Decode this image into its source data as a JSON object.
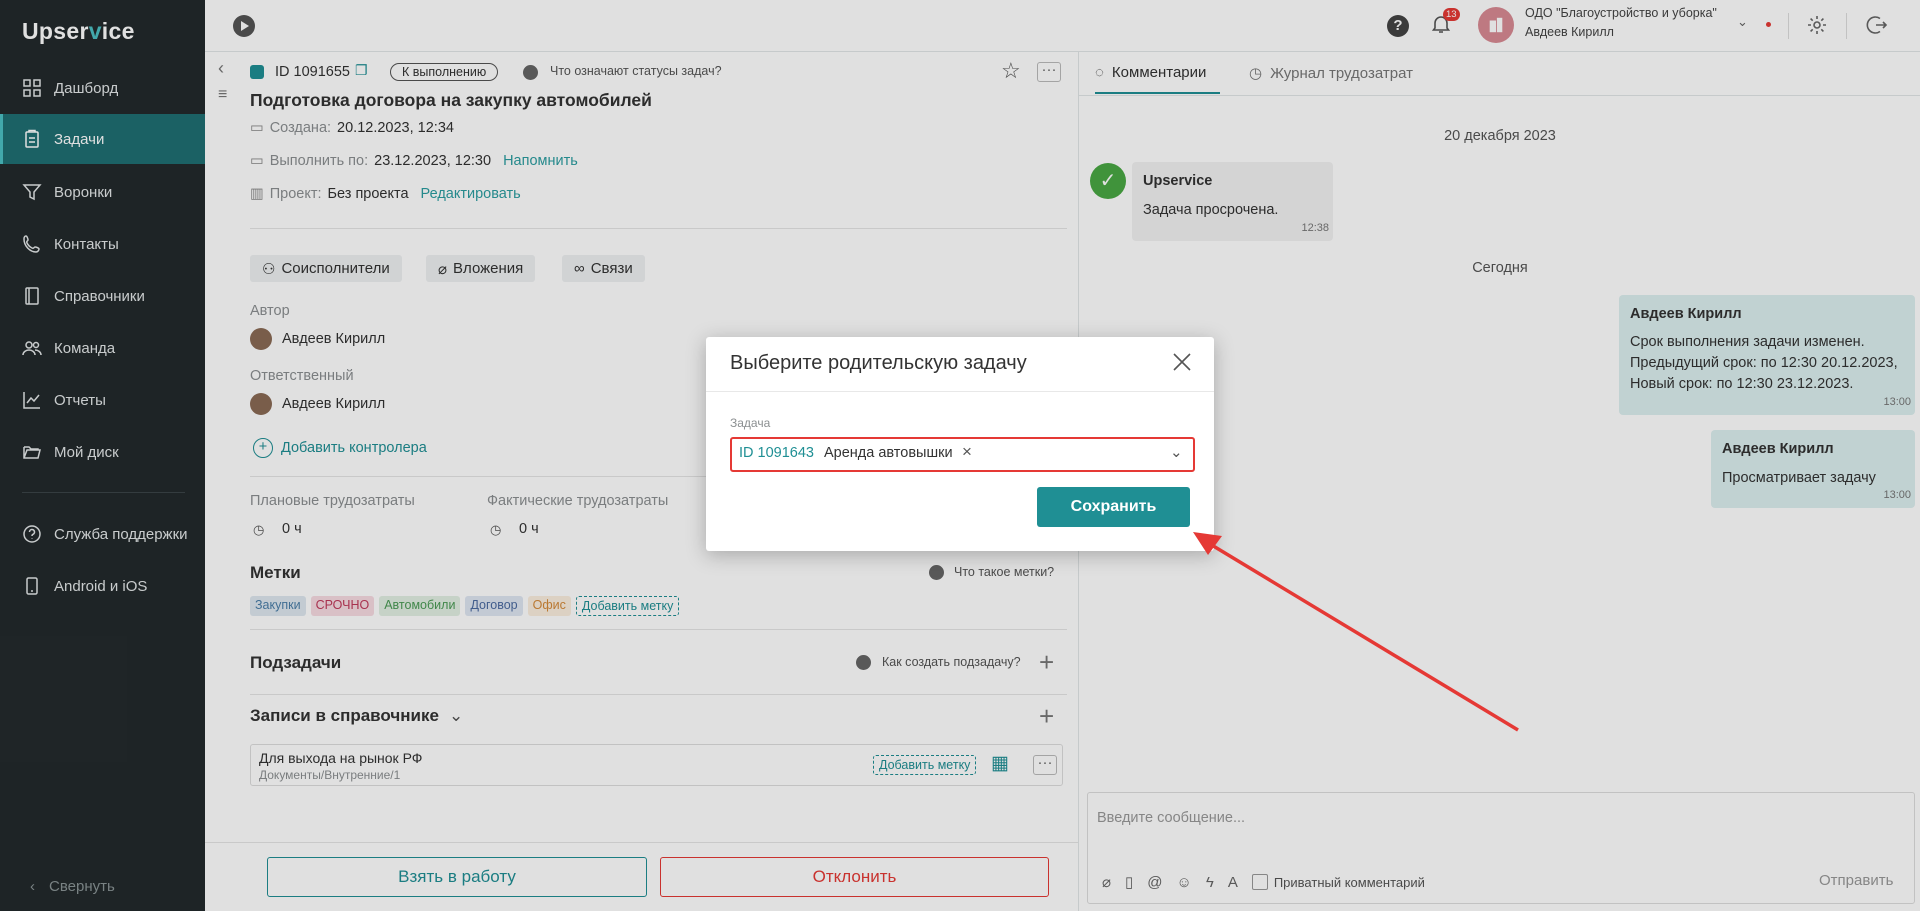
{
  "app": {
    "logo_a": "Upser",
    "logo_b": "v",
    "logo_c": "ice"
  },
  "sidebar": {
    "items": [
      {
        "label": "Дашборд",
        "icon": "dashboard-icon"
      },
      {
        "label": "Задачи",
        "icon": "tasks-icon"
      },
      {
        "label": "Воронки",
        "icon": "funnel-icon"
      },
      {
        "label": "Контакты",
        "icon": "contacts-icon"
      },
      {
        "label": "Справочники",
        "icon": "book-icon"
      },
      {
        "label": "Команда",
        "icon": "team-icon"
      },
      {
        "label": "Отчеты",
        "icon": "reports-icon"
      },
      {
        "label": "Мой диск",
        "icon": "folder-icon"
      },
      {
        "label": "Служба поддержки",
        "icon": "help-icon"
      },
      {
        "label": "Android и iOS",
        "icon": "phone-icon"
      }
    ],
    "collapse_label": "Свернуть"
  },
  "topbar": {
    "notif_count": "13",
    "org_name": "ОДО \"Благоустройство и уборка\"",
    "user_name": "Авдеев Кирилл"
  },
  "task": {
    "id": "ID 1091655",
    "status": "К выполнению",
    "status_help": "Что означают статусы задач?",
    "title": "Подготовка договора на закупку автомобилей",
    "created_label": "Создана:",
    "created_value": "20.12.2023, 12:34",
    "due_label": "Выполнить по:",
    "due_value": "23.12.2023, 12:30",
    "remind": "Напомнить",
    "project_label": "Проект:",
    "project_value": "Без проекта",
    "edit": "Редактировать",
    "tabs": [
      "Соисполнители",
      "Вложения",
      "Связи"
    ],
    "author_label": "Автор",
    "author_name": "Авдеев Кирилл",
    "responsible_label": "Ответственный",
    "responsible_name": "Авдеев Кирилл",
    "add_controller": "Добавить контролера",
    "plan_label": "Плановые трудозатраты",
    "plan_value": "0 ч",
    "fact_label": "Фактические трудозатраты",
    "fact_value": "0 ч",
    "tags_title": "Метки",
    "tags_help": "Что такое метки?",
    "tags": [
      {
        "label": "Закупки",
        "color": "#dfe8ef",
        "text": "#4a7ea8"
      },
      {
        "label": "СРОЧНО",
        "color": "#f7dbe2",
        "text": "#c0395a"
      },
      {
        "label": "Автомобили",
        "color": "#e2f0e3",
        "text": "#4a9a55"
      },
      {
        "label": "Договор",
        "color": "#dfe6f2",
        "text": "#4a6aa0"
      },
      {
        "label": "Офис",
        "color": "#fbeede",
        "text": "#d48a3a"
      }
    ],
    "add_tag": "Добавить метку",
    "subtasks_title": "Подзадачи",
    "subtasks_help": "Как создать подзадачу?",
    "records_title": "Записи в справочнике",
    "record_title": "Для выхода на рынок РФ",
    "record_path": "Документы/Внутренние/1",
    "record_add_tag": "Добавить метку",
    "take_btn": "Взять в работу",
    "reject_btn": "Отклонить"
  },
  "comments": {
    "tab_comments": "Комментарии",
    "tab_journal": "Журнал трудозатрат",
    "date1": "20 декабря 2023",
    "sys_author": "Upservice",
    "sys_text": "Задача просрочена.",
    "sys_time": "12:38",
    "date2": "Сегодня",
    "msg1_author": "Авдеев Кирилл",
    "msg1_line1": "Срок выполнения задачи изменен.",
    "msg1_line2": "Предыдущий срок: по 12:30 20.12.2023,",
    "msg1_line3": "Новый срок: по 12:30 23.12.2023.",
    "msg1_time": "13:00",
    "msg2_author": "Авдеев Кирилл",
    "msg2_text": "Просматривает задачу",
    "msg2_time": "13:00",
    "input_placeholder": "Введите сообщение...",
    "private_label": "Приватный комментарий",
    "send": "Отправить"
  },
  "modal": {
    "title": "Выберите родительскую задачу",
    "field_label": "Задача",
    "selected_id": "ID 1091643",
    "selected_name": "Аренда автовышки",
    "save": "Сохранить"
  },
  "colors": {
    "accent": "#1f8f94",
    "sidebar": "#232a2c",
    "highlight": "#e53935"
  }
}
